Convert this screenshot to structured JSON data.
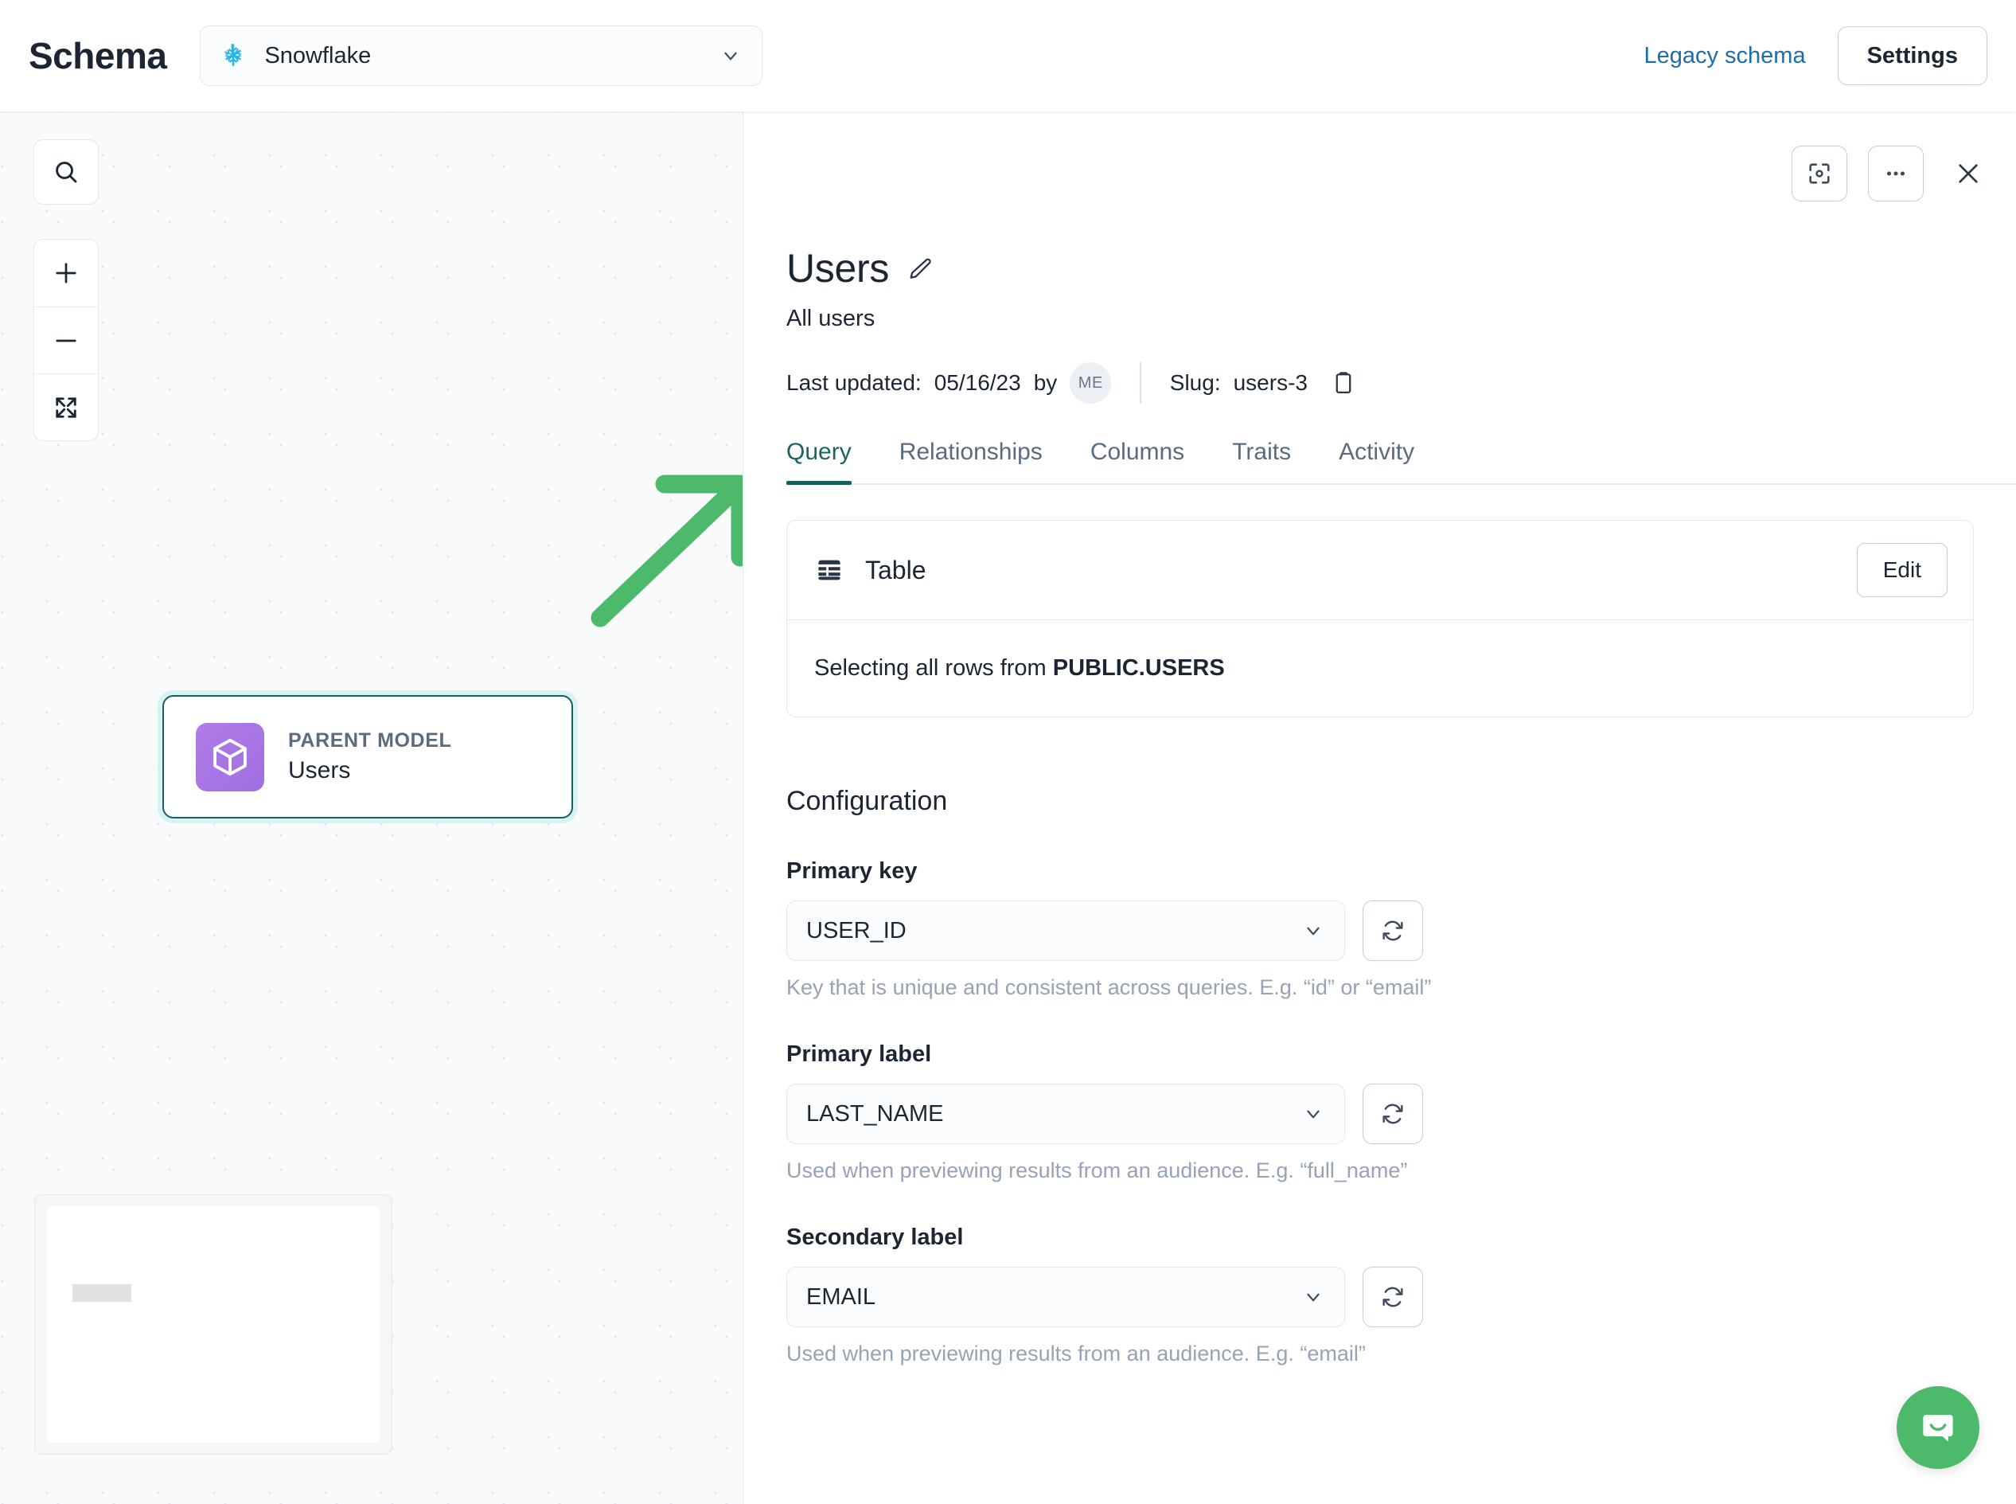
{
  "header": {
    "brand": "Schema",
    "source": {
      "label": "Snowflake",
      "icon": "snowflake-icon",
      "chevron": "chevron-down-icon"
    },
    "legacy_link": "Legacy schema",
    "settings_button": "Settings"
  },
  "canvas": {
    "search_icon": "search-icon",
    "zoom_in_icon": "plus-icon",
    "zoom_out_icon": "minus-icon",
    "fit_view_icon": "expand-icon",
    "node": {
      "kicker": "PARENT MODEL",
      "name": "Users",
      "icon": "cube-icon",
      "icon_color": "#a974e0",
      "selected_border_color": "#175f5b"
    },
    "minimap": {
      "label": "minimap"
    }
  },
  "annotation": {
    "arrow_color": "#4cb96b",
    "points_to": "Query tab"
  },
  "panel": {
    "title": "Users",
    "edit_icon": "pencil-icon",
    "subtitle": "All users",
    "meta": {
      "last_updated_label": "Last updated:",
      "last_updated_date": "05/16/23",
      "by_label": "by",
      "author_initials": "ME",
      "slug_label": "Slug:",
      "slug_value": "users-3",
      "copy_icon": "clipboard-icon"
    },
    "actions": {
      "focus_icon": "focus-frame-icon",
      "more_icon": "ellipsis-icon",
      "close_icon": "close-icon"
    },
    "tabs": [
      {
        "label": "Query",
        "active": true
      },
      {
        "label": "Relationships",
        "active": false
      },
      {
        "label": "Columns",
        "active": false
      },
      {
        "label": "Traits",
        "active": false
      },
      {
        "label": "Activity",
        "active": false
      }
    ],
    "active_tab_color": "#15605c",
    "query_card": {
      "icon": "table-icon",
      "title": "Table",
      "edit_button": "Edit",
      "description_prefix": "Selecting all rows from ",
      "description_target": "PUBLIC.USERS"
    },
    "configuration": {
      "heading": "Configuration",
      "fields": [
        {
          "label": "Primary key",
          "value": "USER_ID",
          "help": "Key that is unique and consistent across queries. E.g. “id” or “email”",
          "chevron": "chevron-down-icon",
          "refresh": "refresh-icon"
        },
        {
          "label": "Primary label",
          "value": "LAST_NAME",
          "help": "Used when previewing results from an audience. E.g. “full_name”",
          "chevron": "chevron-down-icon",
          "refresh": "refresh-icon"
        },
        {
          "label": "Secondary label",
          "value": "EMAIL",
          "help": "Used when previewing results from an audience. E.g. “email”",
          "chevron": "chevron-down-icon",
          "refresh": "refresh-icon"
        }
      ]
    }
  },
  "chat": {
    "icon": "chat-bubble-icon",
    "color": "#4cb96b"
  }
}
